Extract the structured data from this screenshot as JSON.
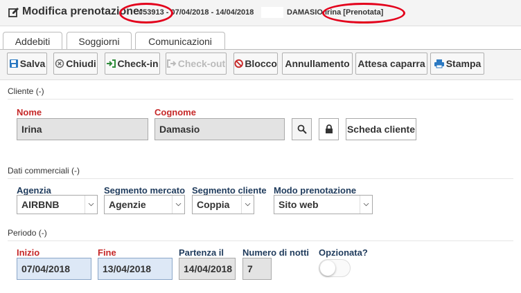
{
  "header": {
    "title": "Modifica prenotazione:",
    "booking_info": "#53913 - 07/04/2018 - 14/04/2018",
    "guest_info": "DAMASIO Irina [Prenotata]"
  },
  "tabs": [
    {
      "label": "Addebiti"
    },
    {
      "label": "Soggiorni"
    },
    {
      "label": "Comunicazioni"
    }
  ],
  "toolbar": {
    "save": "Salva",
    "close": "Chiudi",
    "checkin": "Check-in",
    "checkout": "Check-out",
    "block": "Blocco",
    "cancel": "Annullamento",
    "deposit": "Attesa caparra",
    "print": "Stampa"
  },
  "client": {
    "section": "Cliente (-)",
    "name_label": "Nome",
    "name_value": "Irina",
    "surname_label": "Cognome",
    "surname_value": "Damasio",
    "card_button": "Scheda cliente"
  },
  "commercial": {
    "section": "Dati commerciali (-)",
    "agency_label": "Agenzia",
    "agency_value": "AIRBNB",
    "market_label": "Segmento mercato",
    "market_value": "Agenzie",
    "client_segment_label": "Segmento cliente",
    "client_segment_value": "Coppia",
    "booking_mode_label": "Modo prenotazione",
    "booking_mode_value": "Sito web"
  },
  "period": {
    "section": "Periodo (-)",
    "start_label": "Inizio",
    "start_value": "07/04/2018",
    "end_label": "Fine",
    "end_value": "13/04/2018",
    "departure_label": "Partenza il",
    "departure_value": "14/04/2018",
    "nights_label": "Numero di notti",
    "nights_value": "7",
    "optioned_label": "Opzionata?",
    "optioned": false
  },
  "colors": {
    "required_label": "#c62828",
    "field_label": "#1f3b5c",
    "annotation": "#e3001b",
    "date_field": "#dde8f6"
  }
}
